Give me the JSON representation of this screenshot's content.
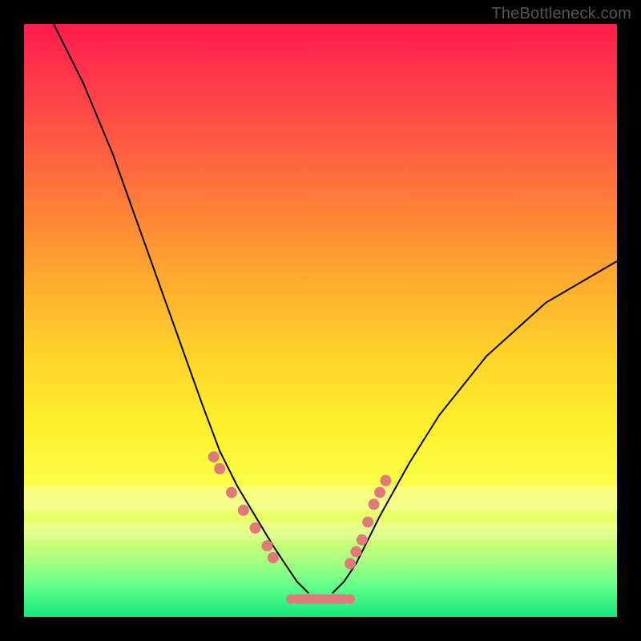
{
  "watermark": "TheBottleneck.com",
  "colors": {
    "marker": "#e07a7a",
    "curve": "#000000",
    "frame": "#000000"
  },
  "chart_data": {
    "type": "line",
    "title": "",
    "xlabel": "",
    "ylabel": "",
    "xlim": [
      0,
      100
    ],
    "ylim": [
      0,
      100
    ],
    "grid": false,
    "legend": false,
    "description": "Bottleneck-style V curve on a vertical red-to-green gradient. Two black curves descend from the top edges into a flat valley near the bottom; salmon dots mark points near the valley on both descending branches and along the flat bottom segment.",
    "series": [
      {
        "name": "left-curve",
        "x": [
          5,
          10,
          15,
          20,
          25,
          30,
          33,
          36,
          39,
          42,
          44,
          46,
          48
        ],
        "y": [
          100,
          90,
          78,
          64,
          50,
          36,
          28,
          22,
          17,
          12,
          9,
          6,
          4
        ]
      },
      {
        "name": "right-curve",
        "x": [
          52,
          54,
          56,
          58,
          60,
          65,
          70,
          78,
          88,
          100
        ],
        "y": [
          4,
          6,
          9,
          13,
          17,
          26,
          34,
          44,
          53,
          60
        ]
      },
      {
        "name": "valley-flat",
        "x": [
          46,
          48,
          50,
          52,
          54
        ],
        "y": [
          3,
          3,
          3,
          3,
          3
        ]
      }
    ],
    "markers": {
      "left_branch": [
        [
          32,
          27
        ],
        [
          33,
          25
        ],
        [
          35,
          21
        ],
        [
          37,
          18
        ],
        [
          39,
          15
        ],
        [
          41,
          12
        ],
        [
          42,
          10
        ]
      ],
      "right_branch": [
        [
          55,
          9
        ],
        [
          56,
          11
        ],
        [
          57,
          13
        ],
        [
          58,
          16
        ],
        [
          59,
          19
        ],
        [
          60,
          21
        ],
        [
          61,
          23
        ]
      ],
      "valley": [
        [
          45,
          3
        ],
        [
          47,
          3
        ],
        [
          49,
          3
        ],
        [
          51,
          3
        ],
        [
          53,
          3
        ],
        [
          55,
          3
        ]
      ]
    }
  }
}
